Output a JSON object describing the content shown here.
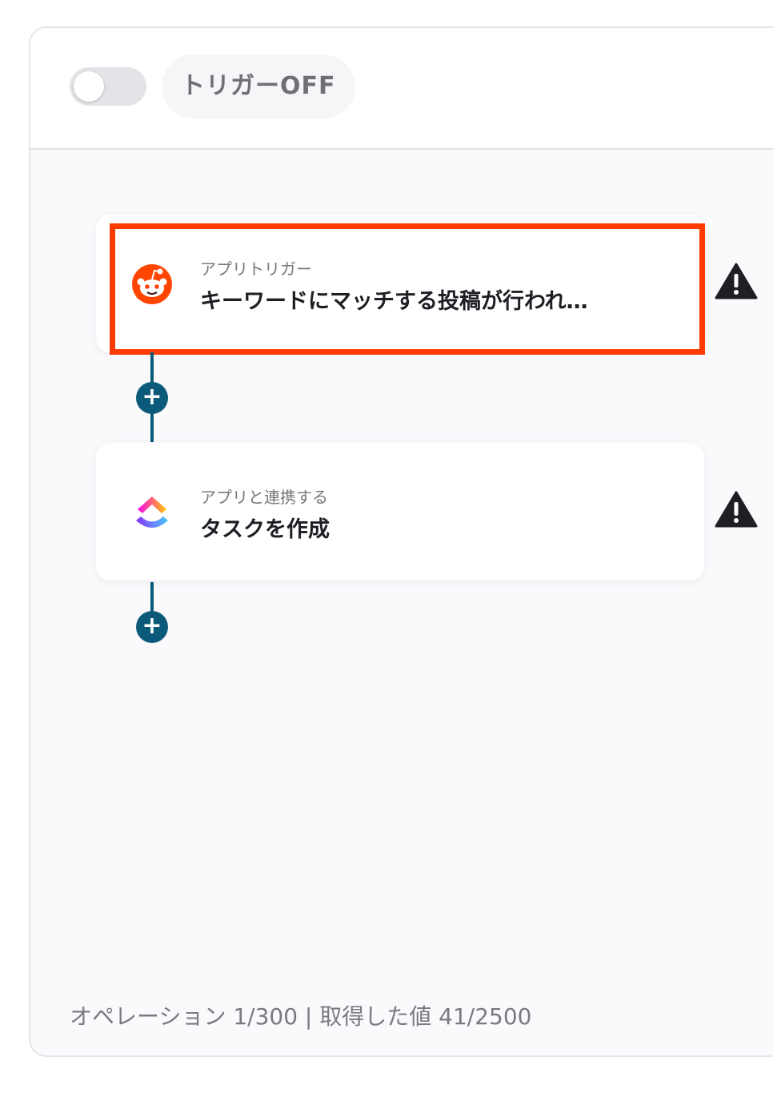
{
  "header": {
    "trigger_status_label": "トリガーOFF"
  },
  "steps": [
    {
      "subtitle": "アプリトリガー",
      "title": "キーワードにマッチする投稿が行われ…",
      "icon": "reddit-icon",
      "highlight_color": "#ff3b00"
    },
    {
      "subtitle": "アプリと連携する",
      "title": "タスクを作成",
      "icon": "clickup-icon"
    }
  ],
  "add_button_label": "+",
  "footer": {
    "usage_text": "オペレーション 1/300 | 取得した値 41/2500"
  },
  "colors": {
    "connector": "#0b5a7a",
    "warning": "#1e1e24",
    "reddit": "#ff4500"
  }
}
